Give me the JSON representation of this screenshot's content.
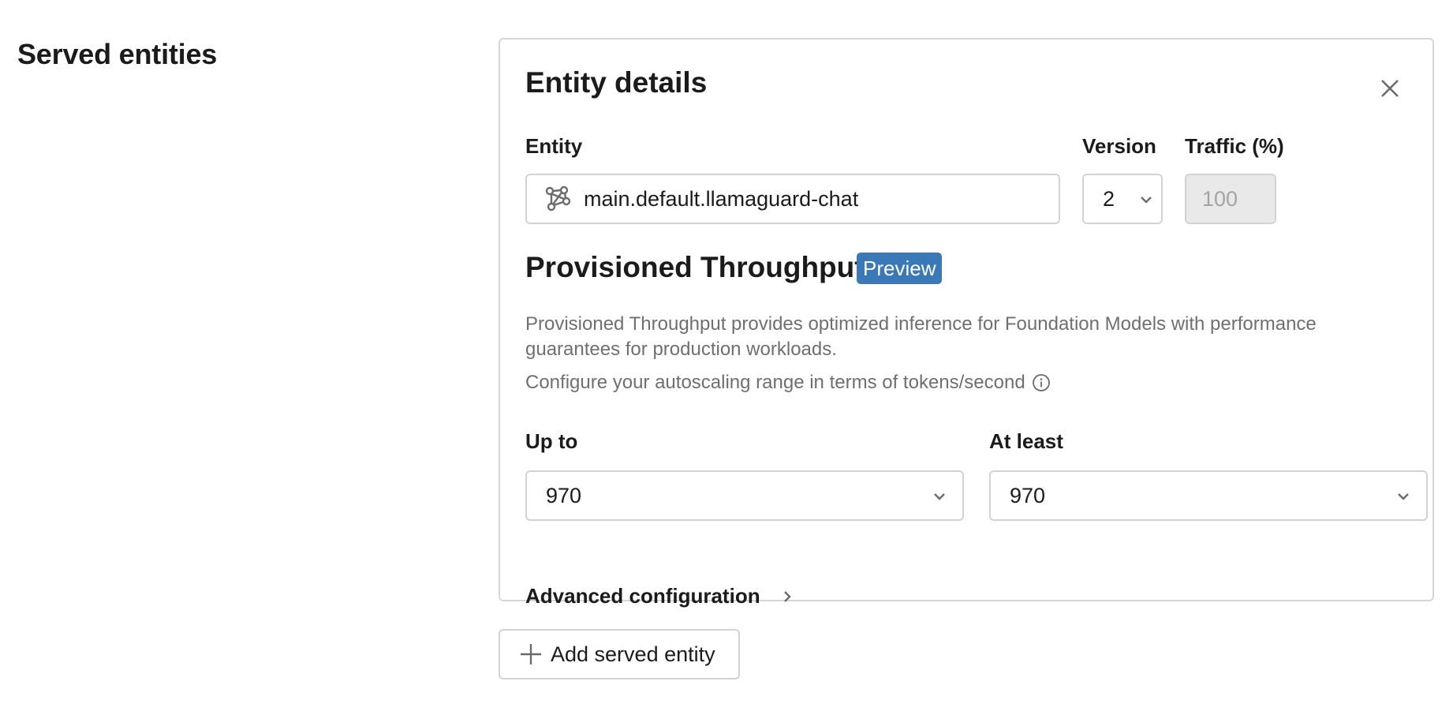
{
  "section": {
    "title": "Served entities"
  },
  "entity_card": {
    "title": "Entity details",
    "close_icon": "close-icon",
    "entity": {
      "label": "Entity",
      "icon": "model-graph-icon",
      "value": "main.default.llamaguard-chat"
    },
    "version": {
      "label": "Version",
      "value": "2",
      "icon": "chevron-down-icon"
    },
    "traffic": {
      "label": "Traffic (%)",
      "value": "100",
      "disabled": true
    },
    "provisioned_throughput": {
      "title": "Provisioned Throughput",
      "badge": "Preview",
      "badge_color": "#3b78b7",
      "description": "Provisioned Throughput provides optimized inference for Foundation Models with performance guarantees for production workloads.",
      "range_hint": "Configure your autoscaling range in terms of tokens/second",
      "info_icon": "info-icon",
      "up_to": {
        "label": "Up to",
        "value": "970"
      },
      "at_least": {
        "label": "At least",
        "value": "970"
      }
    },
    "advanced": {
      "label": "Advanced configuration",
      "icon": "chevron-right-icon"
    }
  },
  "add_button": {
    "label": "Add served entity",
    "icon": "plus-icon"
  }
}
